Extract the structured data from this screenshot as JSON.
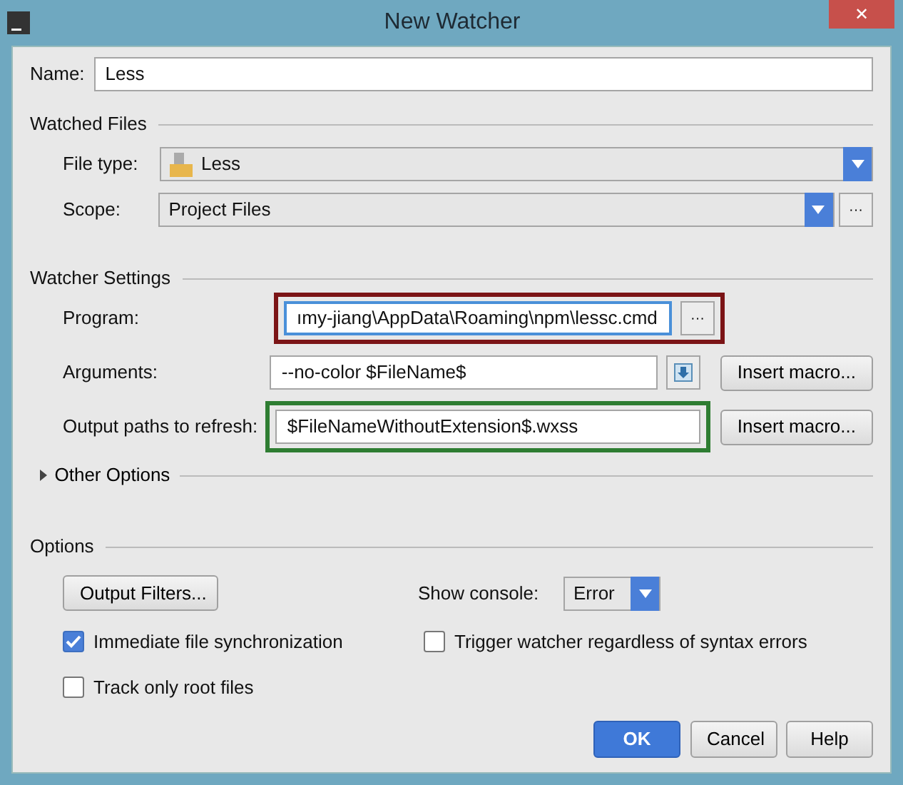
{
  "window": {
    "title": "New Watcher",
    "close": "✕"
  },
  "name": {
    "label": "Name:",
    "value": "Less"
  },
  "watched_files": {
    "title": "Watched Files",
    "file_type": {
      "label": "File type:",
      "value": "Less"
    },
    "scope": {
      "label": "Scope:",
      "value": "Project Files",
      "browse": "···"
    }
  },
  "watcher_settings": {
    "title": "Watcher Settings",
    "fields": [
      {
        "kind": "browse",
        "label": "Program:",
        "value": "ımy-jiang\\AppData\\Roaming\\npm\\lessc.cmd",
        "focused": true,
        "browse": "···",
        "color": "#7b1416"
      },
      {
        "kind": "expand",
        "label": "Arguments:",
        "value": "--no-color $FileName$",
        "focused": false,
        "macro": "Insert macro..."
      },
      {
        "kind": "macro",
        "label": "Output paths to refresh:",
        "value": "$FileNameWithoutExtension$.wxss",
        "focused": false,
        "macro": "Insert macro...",
        "color": "#2e7d32"
      }
    ],
    "other_options": {
      "label": "Other Options",
      "expanded": false
    }
  },
  "options": {
    "title": "Options",
    "output_filters": "Output Filters...",
    "show_console": {
      "label": "Show console:",
      "value": "Error"
    },
    "checkboxes": [
      {
        "label": "Immediate file synchronization",
        "checked": true
      },
      {
        "label": "Trigger watcher regardless of syntax errors",
        "checked": false
      },
      {
        "label": "Track only root files",
        "checked": false
      }
    ]
  },
  "buttons": [
    {
      "label": "OK",
      "default": true
    },
    {
      "label": "Cancel",
      "default": false
    },
    {
      "label": "Help",
      "default": false
    }
  ]
}
